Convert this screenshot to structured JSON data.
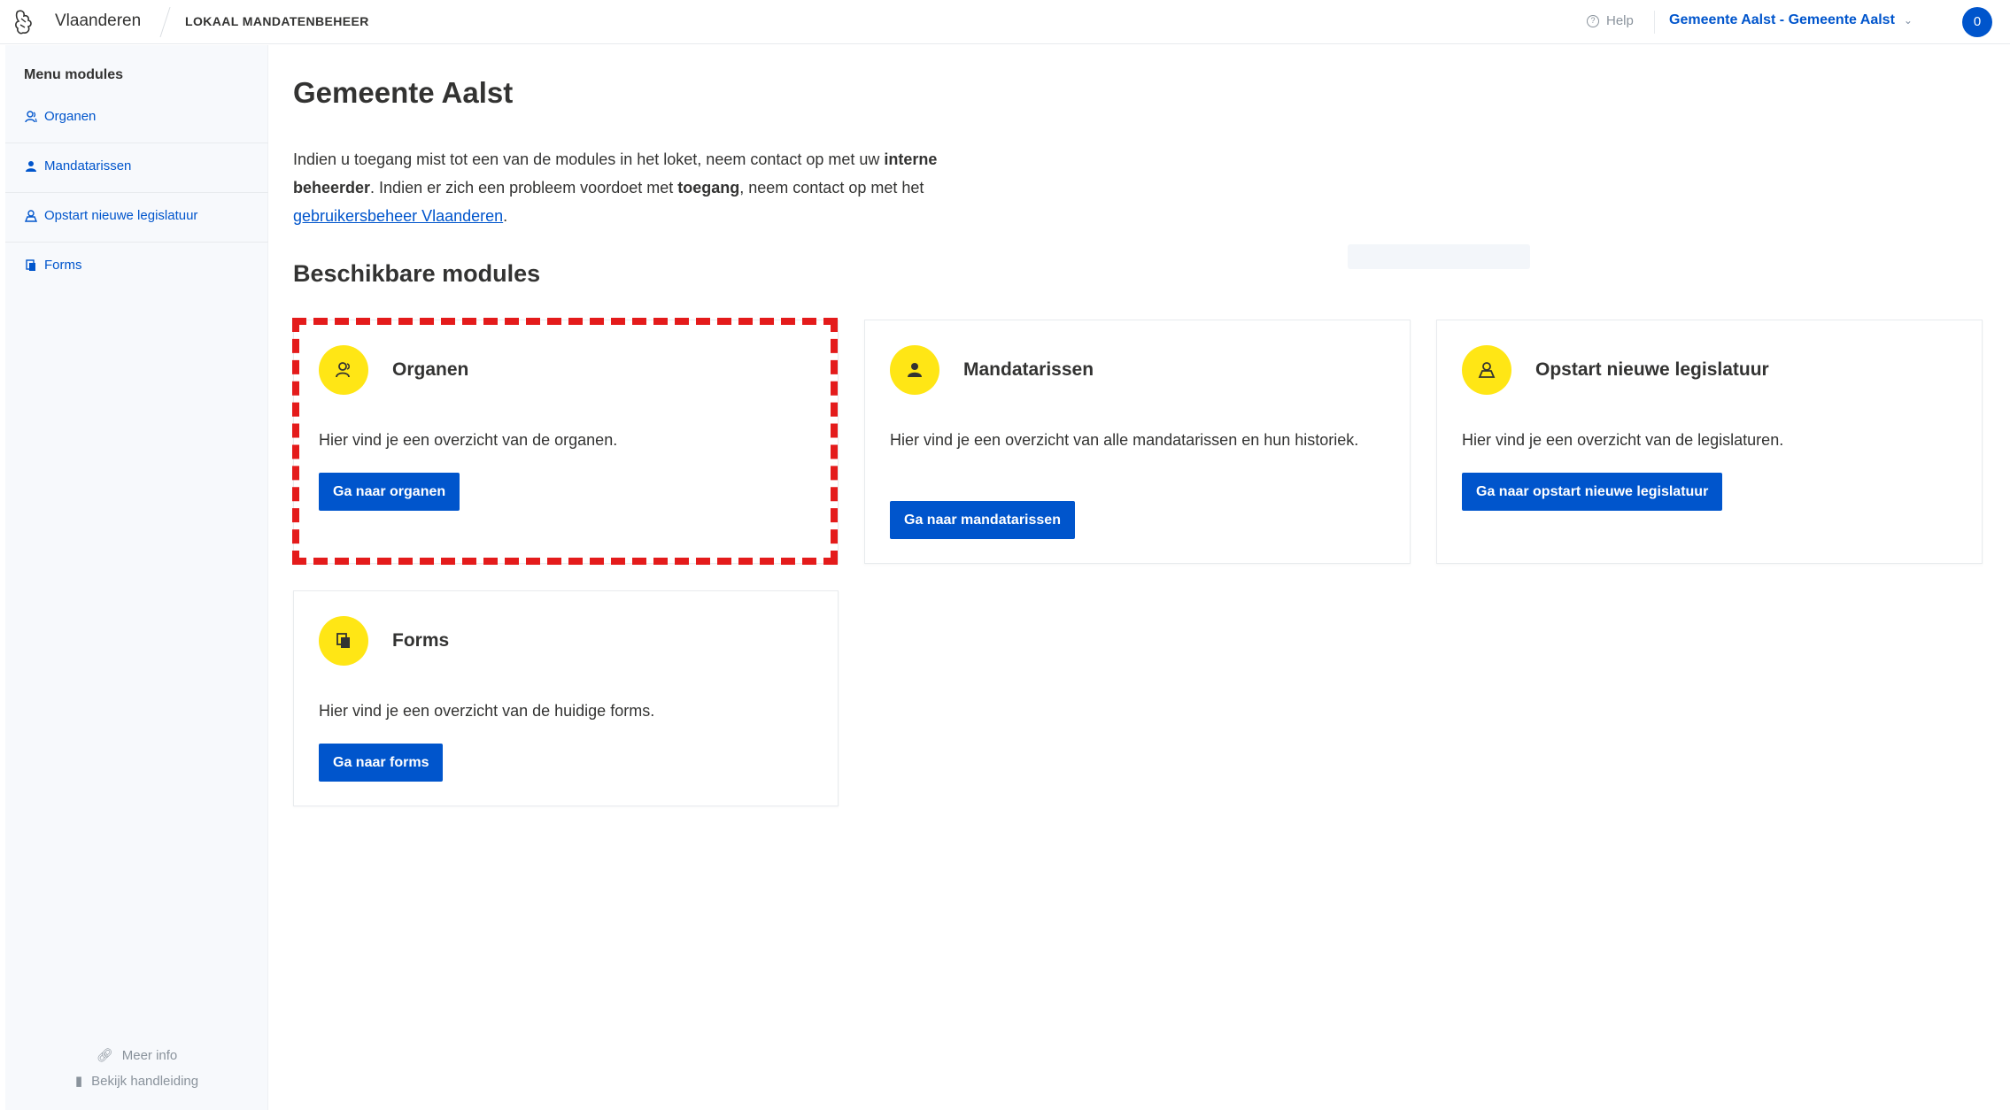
{
  "header": {
    "brand": "Vlaanderen",
    "app_name": "LOKAAL MANDATENBEHEER",
    "help_label": "Help",
    "org_selector": "Gemeente Aalst - Gemeente Aalst",
    "avatar_initial": "0"
  },
  "sidebar": {
    "title": "Menu modules",
    "items": [
      {
        "label": "Organen",
        "icon": "users-icon"
      },
      {
        "label": "Mandatarissen",
        "icon": "user-icon"
      },
      {
        "label": "Opstart nieuwe legislatuur",
        "icon": "person-admin-icon"
      },
      {
        "label": "Forms",
        "icon": "document-icon"
      }
    ],
    "footer": {
      "more_info": "Meer info",
      "manual": "Bekijk handleiding"
    }
  },
  "main": {
    "title": "Gemeente Aalst",
    "intro": {
      "part1": "Indien u toegang mist tot een van de modules in het loket, neem contact op met uw ",
      "bold1": "interne beheerder",
      "part2": ". Indien er zich een probleem voordoet met ",
      "bold2": "toegang",
      "part3": ", neem contact op met het ",
      "link": "gebruikersbeheer Vlaanderen",
      "part4": "."
    },
    "section_title": "Beschikbare modules",
    "modules": [
      {
        "title": "Organen",
        "description": "Hier vind je een overzicht van de organen.",
        "button": "Ga naar organen"
      },
      {
        "title": "Mandatarissen",
        "description": "Hier vind je een overzicht van alle mandatarissen en hun historiek.",
        "button": "Ga naar mandatarissen"
      },
      {
        "title": "Opstart nieuwe legislatuur",
        "description": "Hier vind je een overzicht van de legislaturen.",
        "button": "Ga naar opstart nieuwe legislatuur"
      },
      {
        "title": "Forms",
        "description": "Hier vind je een overzicht van de huidige forms.",
        "button": "Ga naar forms"
      }
    ]
  },
  "colors": {
    "accent_blue": "#0055cc",
    "icon_yellow": "#ffe615",
    "highlight_red": "#e41b1b"
  }
}
